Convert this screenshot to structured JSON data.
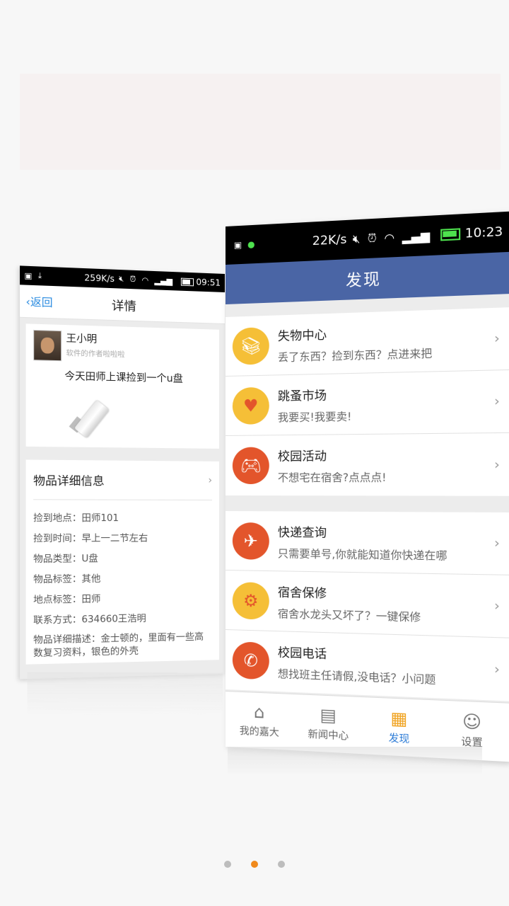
{
  "left_screen": {
    "status": {
      "speed": "259K/s",
      "time": "09:51"
    },
    "nav": {
      "back": "返回",
      "title": "详情"
    },
    "post": {
      "user_name": "王小明",
      "user_subtitle": "软件的作者啦啦啦",
      "text": "今天田师上课捡到一个u盘"
    },
    "info": {
      "header": "物品详细信息",
      "rows": [
        "捡到地点：田师101",
        "捡到时间：早上一二节左右",
        "物品类型：U盘",
        "物品标签：其他",
        "地点标签：田师",
        "联系方式：634660王浩明"
      ],
      "description": "物品详细描述：金士顿的，里面有一些高数复习资料，银色的外壳"
    }
  },
  "right_screen": {
    "status": {
      "speed": "22K/s",
      "time": "10:23"
    },
    "header_title": "发现",
    "groups": [
      [
        {
          "title": "失物中心",
          "subtitle": "丢了东西？捡到东西？点进来把",
          "color": "#f5bf37",
          "icon": "books-icon"
        },
        {
          "title": "跳蚤市场",
          "subtitle": "我要买!我要卖!",
          "color": "#f5bf37",
          "icon": "heart-plus-icon"
        },
        {
          "title": "校园活动",
          "subtitle": "不想宅在宿舍?点点点!",
          "color": "#e3552b",
          "icon": "gamepad-icon"
        }
      ],
      [
        {
          "title": "快递查询",
          "subtitle": "只需要单号,你就能知道你快递在哪",
          "color": "#e3552b",
          "icon": "plane-icon"
        },
        {
          "title": "宿舍保修",
          "subtitle": "宿舍水龙头又坏了？一键保修",
          "color": "#f5bf37",
          "icon": "gears-icon"
        },
        {
          "title": "校园电话",
          "subtitle": "想找班主任请假,没电话？小问题",
          "color": "#e3552b",
          "icon": "phone-icon"
        }
      ]
    ],
    "tabs": [
      {
        "label": "我的嘉大",
        "icon": "home-icon",
        "glyph": "⌂",
        "active": false
      },
      {
        "label": "新闻中心",
        "icon": "news-icon",
        "glyph": "▤",
        "active": false
      },
      {
        "label": "发现",
        "icon": "discover-grid-icon",
        "glyph": "▦",
        "active": true
      },
      {
        "label": "设置",
        "icon": "user-settings-icon",
        "glyph": "☺",
        "active": false
      }
    ]
  },
  "pager": {
    "count": 3,
    "active_index": 1
  }
}
